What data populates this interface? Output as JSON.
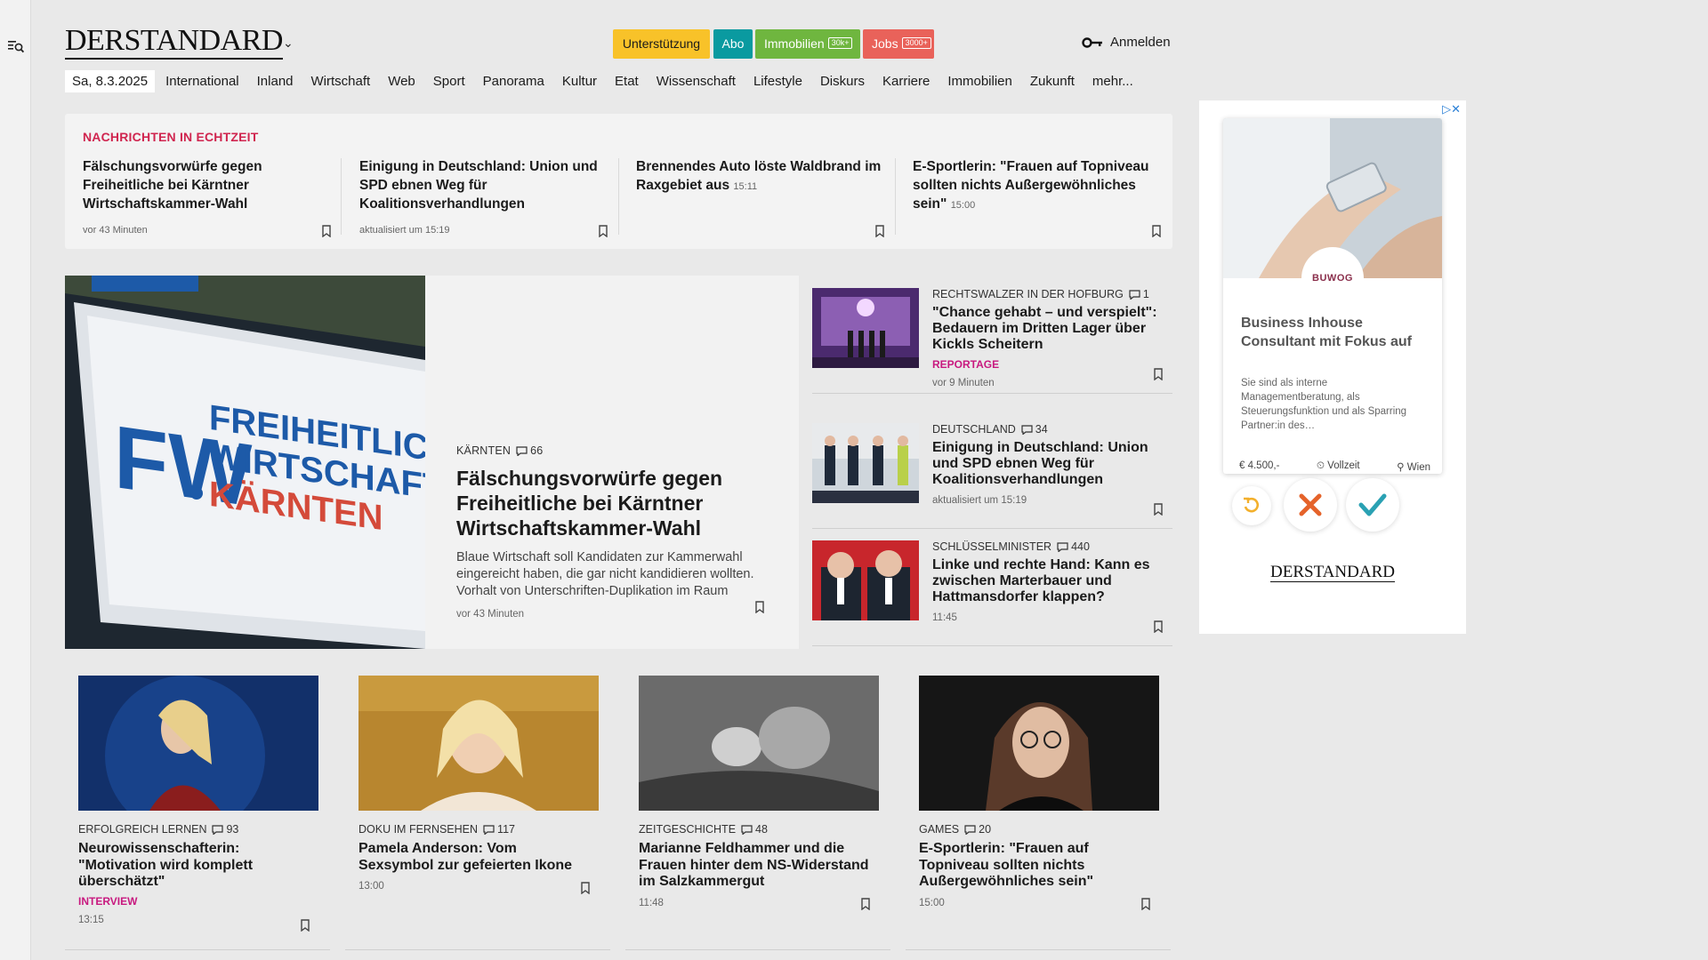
{
  "header": {
    "logo": "DERSTANDARD",
    "pills": {
      "support": "Unterstützung",
      "abo": "Abo",
      "immo": "Immobilien",
      "immo_tag": "30k+",
      "jobs": "Jobs",
      "jobs_tag": "3000+"
    },
    "login": "Anmelden"
  },
  "nav": {
    "date": "Sa, 8.3.2025",
    "items": [
      "International",
      "Inland",
      "Wirtschaft",
      "Web",
      "Sport",
      "Panorama",
      "Kultur",
      "Etat",
      "Wissenschaft",
      "Lifestyle",
      "Diskurs",
      "Karriere",
      "Immobilien",
      "Zukunft",
      "mehr..."
    ]
  },
  "realtime": {
    "title": "NACHRICHTEN IN ECHTZEIT",
    "items": [
      {
        "title": "Fälschungsvorwürfe gegen Freiheitliche bei Kärntner Wirtschaftskammer-Wahl",
        "time": "",
        "meta": "vor 43 Minuten"
      },
      {
        "title": "Einigung in Deutschland: Union und SPD ebnen Weg für Koalitionsverhandlungen",
        "time": "",
        "meta": "aktualisiert um 15:19"
      },
      {
        "title": "Brennendes Auto löste Waldbrand im Raxgebiet aus",
        "time": "15:11",
        "meta": ""
      },
      {
        "title": "E-Sportlerin: \"Frauen auf Topniveau sollten nichts Außergewöhnliches sein\"",
        "time": "15:00",
        "meta": ""
      }
    ]
  },
  "hero": {
    "image_text": {
      "line1": "FREIHEITLICHE",
      "line2": "WIRTSCHAFT",
      "line3": "KÄRNTEN"
    },
    "kicker": "KÄRNTEN",
    "comments": "66",
    "title": "Fälschungsvorwürfe gegen Freiheitliche bei Kärntner Wirtschaftskammer-Wahl",
    "lead": "Blaue Wirtschaft soll Kandidaten zur Kammerwahl eingereicht haben, die gar nicht kandidieren wollten. Vorhalt von Unterschriften-Duplikation im Raum",
    "meta": "vor 43 Minuten"
  },
  "side": [
    {
      "kicker": "RECHTSWALZER IN DER HOFBURG",
      "comments": "1",
      "title": "\"Chance gehabt – und verspielt\": Bedauern im Dritten Lager über Kickls Scheitern",
      "label": "REPORTAGE",
      "meta": "vor 9 Minuten"
    },
    {
      "kicker": "DEUTSCHLAND",
      "comments": "34",
      "title": "Einigung in Deutschland: Union und SPD ebnen Weg für Koalitionsverhandlungen",
      "label": "",
      "meta": "aktualisiert um 15:19"
    },
    {
      "kicker": "SCHLÜSSELMINISTER",
      "comments": "440",
      "title": "Linke und rechte Hand: Kann es zwischen Marterbauer und Hattmansdorfer klappen?",
      "label": "",
      "meta": "11:45"
    }
  ],
  "cards": [
    {
      "kicker": "ERFOLGREICH LERNEN",
      "comments": "93",
      "title": "Neurowissenschafterin: \"Motivation wird komplett überschätzt\"",
      "label": "INTERVIEW",
      "meta": "13:15"
    },
    {
      "kicker": "DOKU IM FERNSEHEN",
      "comments": "117",
      "title": "Pamela Anderson: Vom Sexsymbol zur gefeierten Ikone",
      "label": "",
      "meta": "13:00"
    },
    {
      "kicker": "ZEITGESCHICHTE",
      "comments": "48",
      "title": "Marianne Feldhammer und die Frauen hinter dem NS-Widerstand im Salzkammergut",
      "label": "",
      "meta": "11:48"
    },
    {
      "kicker": "GAMES",
      "comments": "20",
      "title": "E-Sportlerin: \"Frauen auf Topniveau sollten nichts Außergewöhnliches sein\"",
      "label": "",
      "meta": "15:00"
    }
  ],
  "ad": {
    "close": "▷✕",
    "badge": "BUWOG",
    "title": "Business Inhouse Consultant mit Fokus auf",
    "desc": "Sie sind als interne Managementberatung, als Steuerungsfunktion und als Sparring Partner:in des…",
    "salary": "€ 4.500,-",
    "type": "Vollzeit",
    "location": "Wien",
    "logo": "DERSTANDARD"
  },
  "colors": {
    "accent_red": "#d0254f",
    "label_magenta": "#c8197f",
    "abo_teal": "#0a9aa0",
    "support_yellow": "#f8c229",
    "immo_green": "#6fb63f",
    "jobs_red": "#e9625a"
  }
}
